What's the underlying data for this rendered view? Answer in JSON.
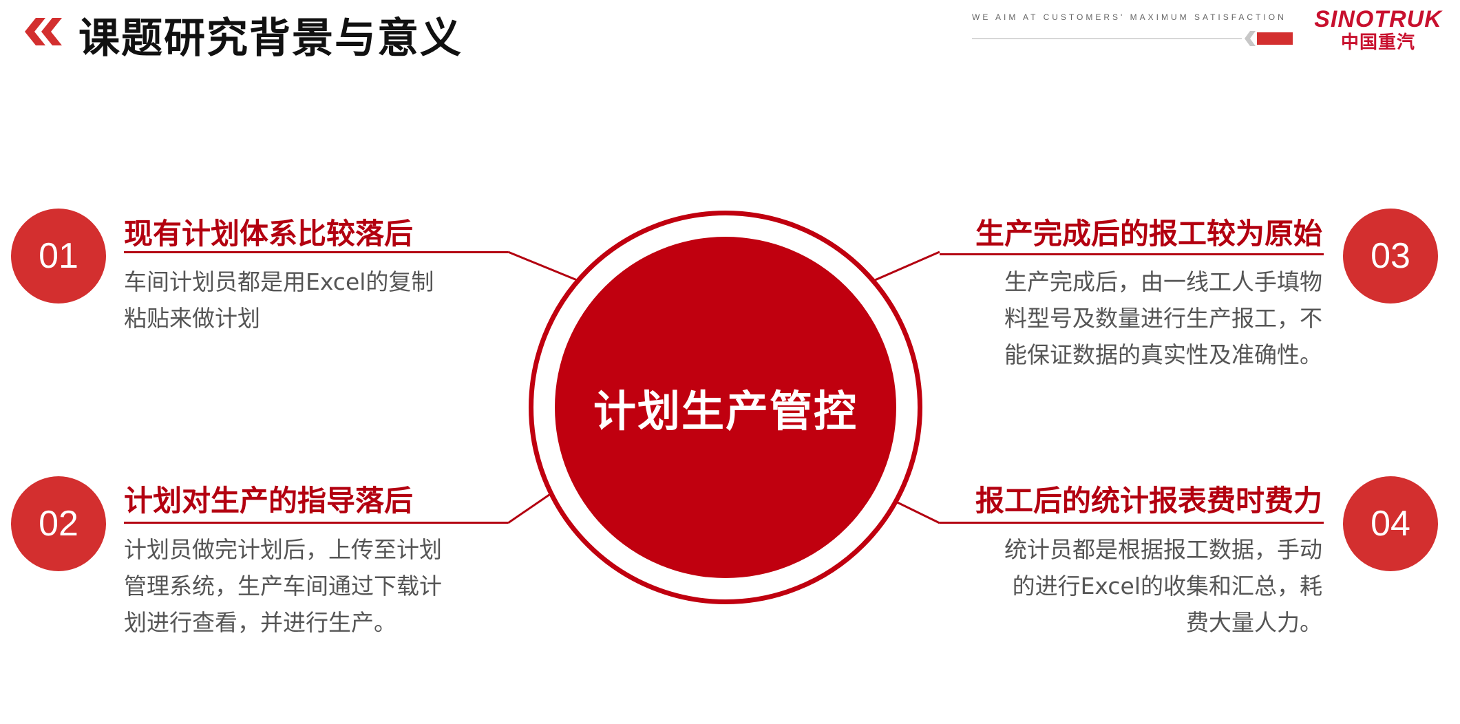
{
  "header": {
    "title": "课题研究背景与意义",
    "tagline": "WE   AIM   AT CUSTOMERS' MAXIMUM   SATISFACTION",
    "brand_en": "SINOTRUK",
    "brand_cn": "中国重汽"
  },
  "center": {
    "title": "计划生产管控"
  },
  "sections": [
    {
      "number": "01",
      "title": "现有计划体系比较落后",
      "lines": [
        "车间计划员都是用Excel的复制",
        "粘贴来做计划"
      ]
    },
    {
      "number": "02",
      "title": "计划对生产的指导落后",
      "lines": [
        "计划员做完计划后，上传至计划",
        "管理系统，生产车间通过下载计",
        "划进行查看，并进行生产。"
      ]
    },
    {
      "number": "03",
      "title": "生产完成后的报工较为原始",
      "lines": [
        "生产完成后，由一线工人手填物",
        "料型号及数量进行生产报工，不",
        "能保证数据的真实性及准确性。"
      ]
    },
    {
      "number": "04",
      "title": "报工后的统计报表费时费力",
      "lines": [
        "统计员都是根据报工数据，手动",
        "的进行Excel的收集和汇总，耗",
        "费大量人力。"
      ]
    }
  ],
  "colors": {
    "accent": "#c0000f",
    "badge": "#d32f2f",
    "brand": "#c8102e"
  }
}
